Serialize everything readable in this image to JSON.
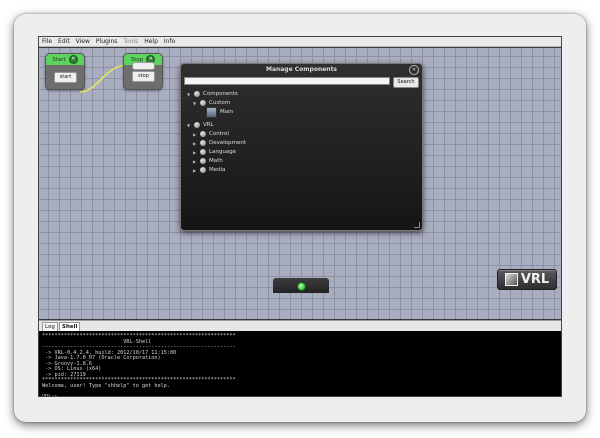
{
  "menu": [
    "File",
    "Edit",
    "View",
    "Plugins",
    "Tools",
    "Help",
    "Info"
  ],
  "menu_disabled": [
    "Tools"
  ],
  "nodes": {
    "start": {
      "title": "Start",
      "button": "start"
    },
    "stop": {
      "title": "Stop",
      "button": "stop"
    }
  },
  "connection_color": "#e8e85a",
  "manage_components": {
    "title": "Manage Components",
    "search_value": "",
    "search_button": "Search",
    "tree": [
      {
        "label": "Components",
        "depth": 0,
        "expanded": true,
        "icon": "ball-icon"
      },
      {
        "label": "Custom",
        "depth": 1,
        "expanded": true,
        "icon": "ball-icon"
      },
      {
        "label": "Main",
        "depth": 2,
        "expanded": null,
        "icon": "component-icon"
      },
      {
        "label": "VRL",
        "depth": 0,
        "expanded": true,
        "icon": "ball-icon"
      },
      {
        "label": "Control",
        "depth": 1,
        "expanded": false,
        "icon": "ball-icon"
      },
      {
        "label": "Development",
        "depth": 1,
        "expanded": false,
        "icon": "ball-icon"
      },
      {
        "label": "Language",
        "depth": 1,
        "expanded": false,
        "icon": "ball-icon"
      },
      {
        "label": "Math",
        "depth": 1,
        "expanded": false,
        "icon": "ball-icon"
      },
      {
        "label": "Media",
        "depth": 1,
        "expanded": false,
        "icon": "ball-icon"
      }
    ]
  },
  "logo": "VRL",
  "tabs": [
    "Log",
    "Shell"
  ],
  "active_tab": "Shell",
  "shell": {
    "lines": [
      "**************************************************************",
      "                          VRL-Shell",
      "--------------------------------------------------------------",
      " -> VRL-0.4.2.4, build: 2012/10/17 11:15:00",
      " -> Java-1.7.0_07 (Oracle Corporation)",
      " -> Groovy-1.8.6",
      " -> OS: Linux (x64)",
      " -> pid: 27119",
      "**************************************************************",
      "Welcome, user! Type \"shhelp\" to get help.",
      "",
      "VRL:>"
    ]
  },
  "colors": {
    "canvas_bg": "#a8adbf",
    "node_title_green": "#5fd35f",
    "shell_bg": "#000000"
  }
}
